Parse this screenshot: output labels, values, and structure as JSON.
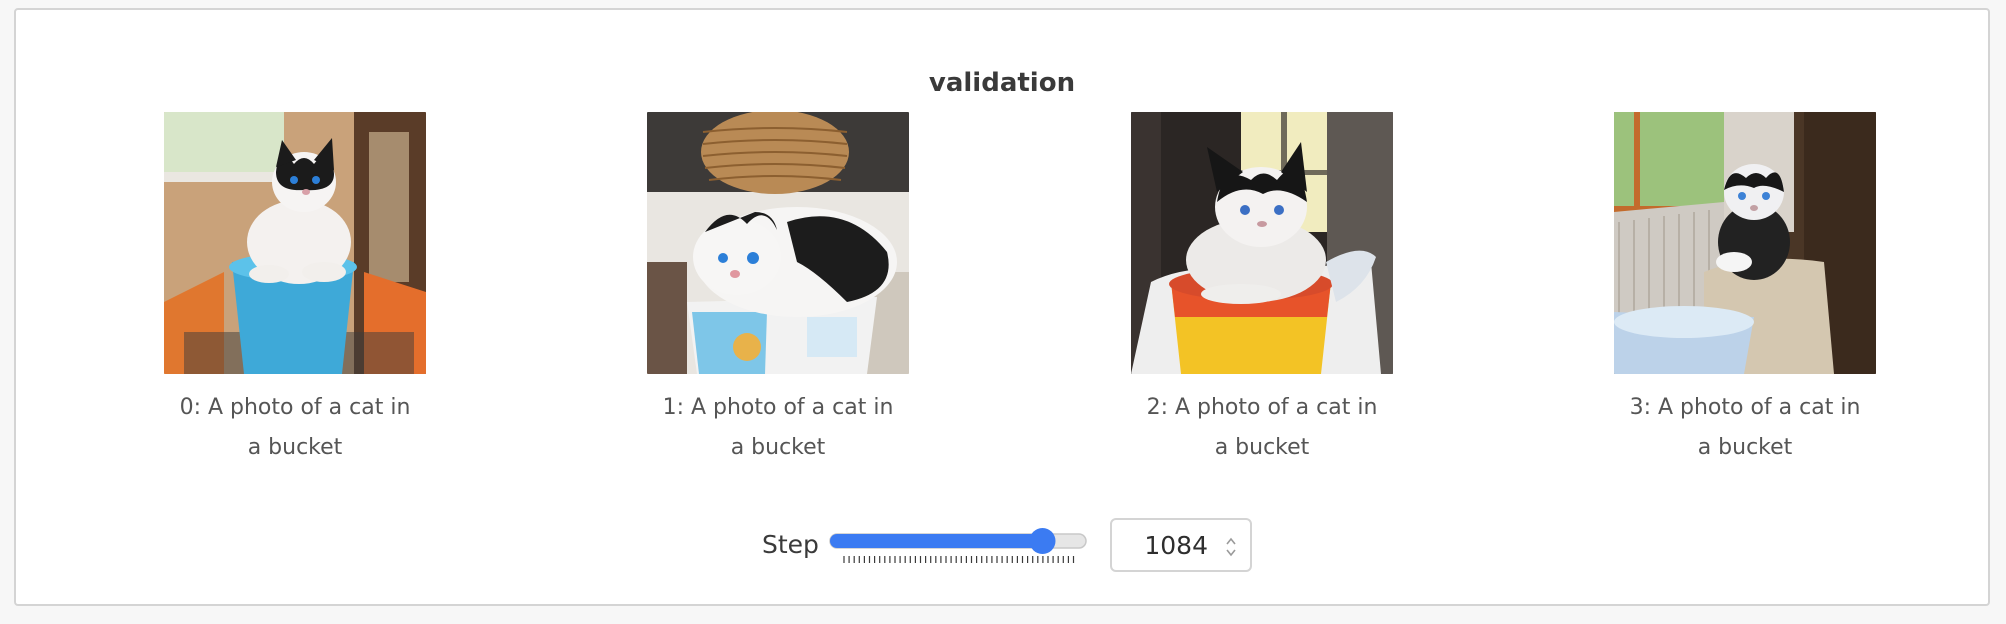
{
  "panel": {
    "title": "validation"
  },
  "images": [
    {
      "caption": "0: A photo of a cat in a bucket",
      "alt": "cat-in-bucket-image"
    },
    {
      "caption": "1: A photo of a cat in a bucket",
      "alt": "cat-in-bucket-image"
    },
    {
      "caption": "2: A photo of a cat in a bucket",
      "alt": "cat-in-bucket-image"
    },
    {
      "caption": "3: A photo of a cat in a bucket",
      "alt": "cat-in-bucket-image"
    }
  ],
  "step": {
    "label": "Step",
    "value": "1084",
    "slider_fraction": 0.83
  },
  "colors": {
    "accent": "#3b7bf2",
    "track": "#e6e6e6",
    "border": "#d4d4d4"
  }
}
